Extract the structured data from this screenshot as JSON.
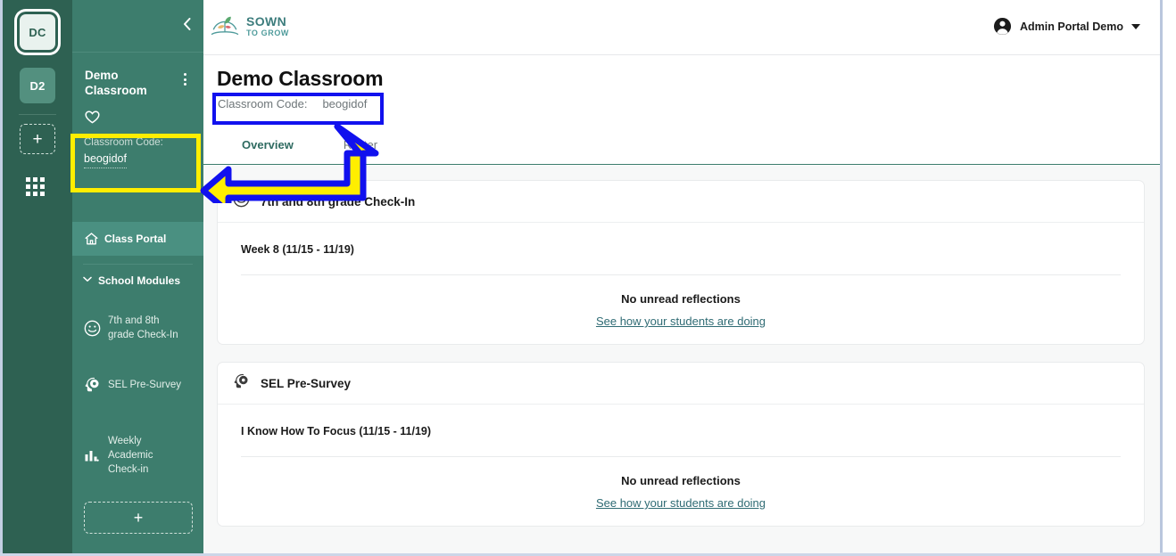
{
  "rail": {
    "tiles": [
      {
        "label": "DC",
        "name": "rail-tile-dc",
        "active": true
      },
      {
        "label": "D2",
        "name": "rail-tile-d2",
        "active": false
      }
    ],
    "add_label": "+",
    "grid_icon": "apps-grid-icon"
  },
  "sidebar": {
    "collapse_icon": "chevron-left-icon",
    "class_title": "Demo Classroom",
    "kebab_icon": "kebab-menu-icon",
    "favorite_icon": "heart-icon",
    "code_label": "Classroom Code:",
    "code_value": "beogidof",
    "portal_item": {
      "label": "Class Portal",
      "icon": "home-icon"
    },
    "modules_header": {
      "label": "School Modules",
      "icon": "chevron-down-icon"
    },
    "modules": [
      {
        "label": "7th and 8th grade Check-In",
        "icon": "smiley-face-icon"
      },
      {
        "label": "SEL Pre-Survey",
        "icon": "head-gear-icon"
      },
      {
        "label": "Weekly Academic Check-in",
        "icon": "bar-chart-icon"
      }
    ],
    "add_label": "+"
  },
  "topbar": {
    "logo": {
      "icon": "sown-to-grow-sprout-icon",
      "line1": "SOWN",
      "line2": "TO GROW"
    },
    "user": {
      "icon": "account-circle-icon",
      "name": "Admin Portal Demo",
      "caret": "chevron-down-icon"
    }
  },
  "page_header": {
    "title": "Demo Classroom",
    "code_label": "Classroom Code:",
    "code_value": "beogidof",
    "tabs": [
      {
        "label": "Overview",
        "active": true
      },
      {
        "label": "Roster",
        "active": false
      }
    ]
  },
  "cards": [
    {
      "icon": "smiley-face-icon",
      "title": "7th and 8th grade Check-In",
      "subtitle": "Week 8 (11/15 - 11/19)",
      "empty_title": "No unread reflections",
      "empty_link": "See how your students are doing"
    },
    {
      "icon": "head-gear-icon",
      "title": "SEL Pre-Survey",
      "subtitle": "I Know How To Focus (11/15 - 11/19)",
      "empty_title": "No unread reflections",
      "empty_link": "See how your students are doing"
    }
  ],
  "annotations": {
    "highlight_box_color": "#ffee00",
    "callout_box_color": "#1111ee",
    "arrow_fill": "#ffee00",
    "arrow_stroke": "#1111ee",
    "sidebar_highlight_target": "Classroom Code: beogidof",
    "header_callout_target": "Classroom Code: beogidof"
  },
  "colors": {
    "rail_bg": "#2e6152",
    "sidebar_bg": "#3d7d6d",
    "sidebar_active": "#4a9081",
    "page_bg": "#f7f8f8",
    "accent_teal": "#2f6b61",
    "link_teal": "#2f6b74"
  }
}
